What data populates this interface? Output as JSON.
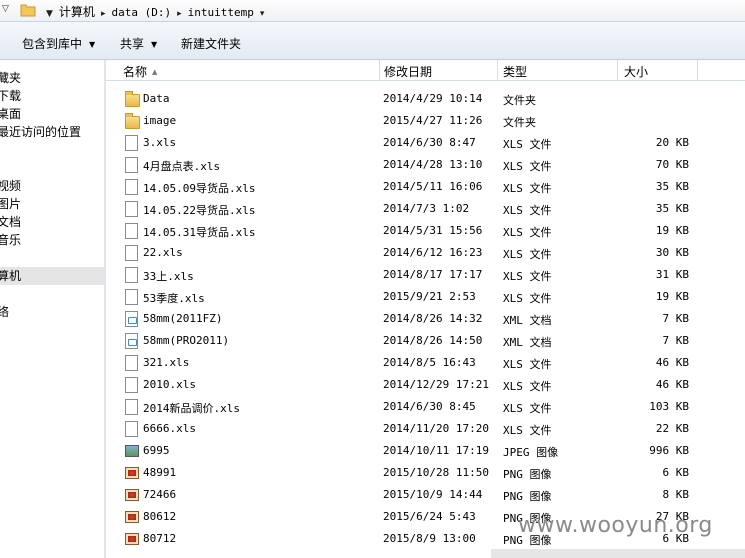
{
  "address": {
    "crumbs": [
      "计算机",
      "data (D:)",
      "intuittemp"
    ]
  },
  "toolbar": {
    "include_label": "包含到库中",
    "share_label": "共享",
    "new_folder_label": "新建文件夹"
  },
  "nav": {
    "items": [
      "藏夹",
      "下载",
      "桌面",
      "最近访问的位置",
      "视频",
      "图片",
      "文档",
      "音乐",
      "算机",
      "络"
    ],
    "selected": "算机"
  },
  "columns": {
    "name": "名称",
    "date": "修改日期",
    "type": "类型",
    "size": "大小"
  },
  "files": [
    {
      "name": "Data",
      "date": "2014/4/29 10:14",
      "type": "文件夹",
      "size": "",
      "icon": "folder"
    },
    {
      "name": "image",
      "date": "2015/4/27 11:26",
      "type": "文件夹",
      "size": "",
      "icon": "folder"
    },
    {
      "name": "3.xls",
      "date": "2014/6/30 8:47",
      "type": "XLS 文件",
      "size": "20 KB",
      "icon": "doc"
    },
    {
      "name": "4月盘点表.xls",
      "date": "2014/4/28 13:10",
      "type": "XLS 文件",
      "size": "70 KB",
      "icon": "doc"
    },
    {
      "name": "14.05.09导货品.xls",
      "date": "2014/5/11 16:06",
      "type": "XLS 文件",
      "size": "35 KB",
      "icon": "doc"
    },
    {
      "name": "14.05.22导货品.xls",
      "date": "2014/7/3 1:02",
      "type": "XLS 文件",
      "size": "35 KB",
      "icon": "doc"
    },
    {
      "name": "14.05.31导货品.xls",
      "date": "2014/5/31 15:56",
      "type": "XLS 文件",
      "size": "19 KB",
      "icon": "doc"
    },
    {
      "name": "22.xls",
      "date": "2014/6/12 16:23",
      "type": "XLS 文件",
      "size": "30 KB",
      "icon": "doc"
    },
    {
      "name": "33上.xls",
      "date": "2014/8/17 17:17",
      "type": "XLS 文件",
      "size": "31 KB",
      "icon": "doc"
    },
    {
      "name": "53季度.xls",
      "date": "2015/9/21 2:53",
      "type": "XLS 文件",
      "size": "19 KB",
      "icon": "doc"
    },
    {
      "name": "58mm(2011FZ)",
      "date": "2014/8/26 14:32",
      "type": "XML 文档",
      "size": "7 KB",
      "icon": "xml"
    },
    {
      "name": "58mm(PRO2011)",
      "date": "2014/8/26 14:50",
      "type": "XML 文档",
      "size": "7 KB",
      "icon": "xml"
    },
    {
      "name": "321.xls",
      "date": "2014/8/5 16:43",
      "type": "XLS 文件",
      "size": "46 KB",
      "icon": "doc"
    },
    {
      "name": "2010.xls",
      "date": "2014/12/29 17:21",
      "type": "XLS 文件",
      "size": "46 KB",
      "icon": "doc"
    },
    {
      "name": "2014新品调价.xls",
      "date": "2014/6/30 8:45",
      "type": "XLS 文件",
      "size": "103 KB",
      "icon": "doc"
    },
    {
      "name": "6666.xls",
      "date": "2014/11/20 17:20",
      "type": "XLS 文件",
      "size": "22 KB",
      "icon": "doc"
    },
    {
      "name": "6995",
      "date": "2014/10/11 17:19",
      "type": "JPEG 图像",
      "size": "996 KB",
      "icon": "jpeg"
    },
    {
      "name": "48991",
      "date": "2015/10/28 11:50",
      "type": "PNG 图像",
      "size": "6 KB",
      "icon": "png"
    },
    {
      "name": "72466",
      "date": "2015/10/9 14:44",
      "type": "PNG 图像",
      "size": "8 KB",
      "icon": "png"
    },
    {
      "name": "80612",
      "date": "2015/6/24 5:43",
      "type": "PNG 图像",
      "size": "27 KB",
      "icon": "png"
    },
    {
      "name": "80712",
      "date": "2015/8/9 13:00",
      "type": "PNG 图像",
      "size": "6 KB",
      "icon": "png"
    }
  ],
  "watermark": "www.wooyun.org"
}
